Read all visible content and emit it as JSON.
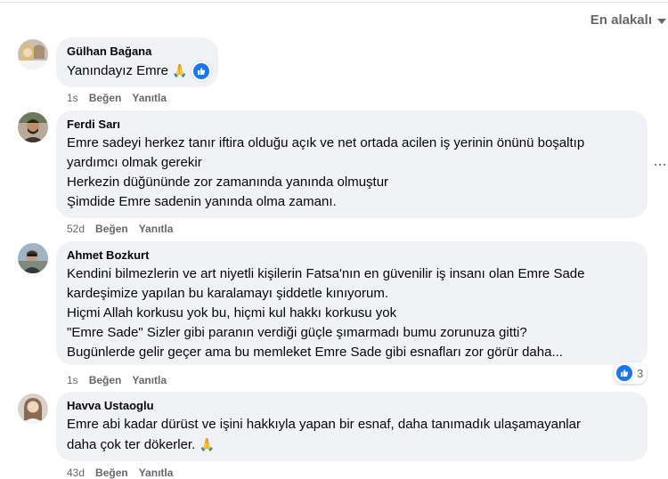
{
  "sort": {
    "label": "En alakalı"
  },
  "comments": [
    {
      "author": "Gülhan Bağana",
      "lines": [
        "Yanındayız Emre"
      ],
      "emoji": "🙏",
      "time": "1s",
      "like": "Beğen",
      "reply": "Yanıtla"
    },
    {
      "author": "Ferdi Sarı",
      "lines": [
        "Emre sadeyi herkez tanır iftira olduğu açık ve net ortada acilen iş yerinin önünü boşaltıp",
        "yardımcı olmak gerekir",
        "Herkezin düğününde zor zamanında yanında olmuştur",
        "Şimdide Emre sadenin yanında olma zamanı."
      ],
      "time": "52d",
      "like": "Beğen",
      "reply": "Yanıtla"
    },
    {
      "author": "Ahmet Bozkurt",
      "lines": [
        "Kendini bilmezlerin ve art niyetli kişilerin Fatsa'nın en güvenilir iş insanı olan Emre Sade",
        "kardeşimize yapılan bu karalamayı şiddetle kınıyorum.",
        "Hiçmi Allah korkusu yok bu, hiçmi kul hakkı korkusu yok",
        "\"Emre Sade\" Sizler gibi paranın verdiği güçle şımarmadı bumu zorunuza gitti?",
        "Bugünlerde gelir geçer ama bu memleket Emre Sade gibi esnafları zor görür daha..."
      ],
      "reactions": "3",
      "time": "1s",
      "like": "Beğen",
      "reply": "Yanıtla"
    },
    {
      "author": "Havva Ustaoglu",
      "lines": [
        "Emre abi kadar dürüst ve işini hakkıyla yapan bir esnaf, daha tanımadık ulaşamayanlar",
        "daha çok ter dökerler."
      ],
      "emoji": "🙏",
      "time": "43d",
      "like": "Beğen",
      "reply": "Yanıtla"
    }
  ]
}
